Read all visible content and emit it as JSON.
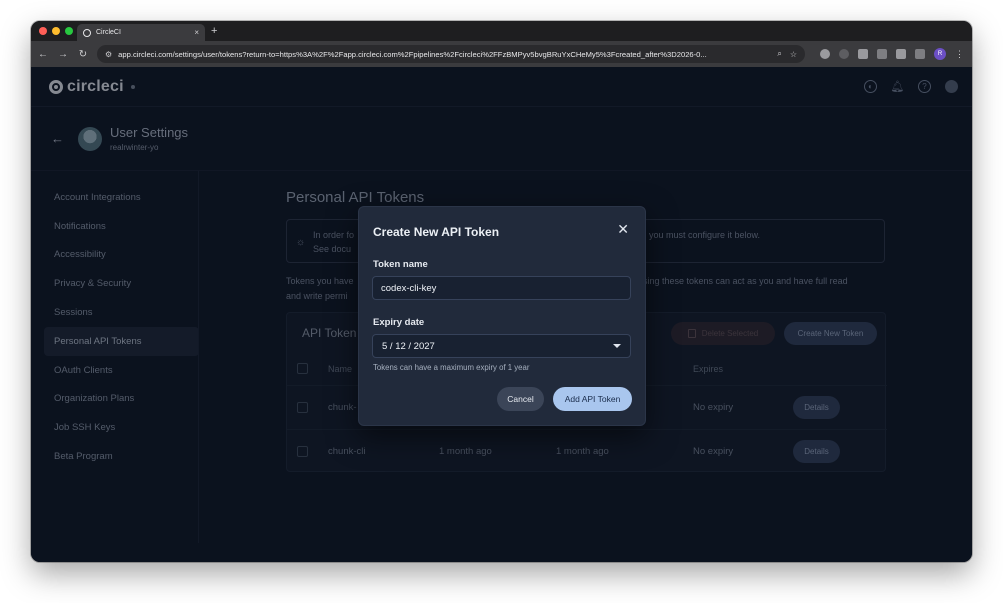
{
  "browser": {
    "tab_title": "CircleCI",
    "tab_close": "×",
    "new_tab": "+",
    "url": "app.circleci.com/settings/user/tokens?return-to=https%3A%2F%2Fapp.circleci.com%2Fpipelines%2Fcircleci%2FFzBMPyv5bvgBRuYxCHeMy5%3Fcreated_after%3D2026-0...",
    "profile_initial": "R",
    "traffic_light_colors": [
      "#ff5f57",
      "#febc2e",
      "#28c840"
    ]
  },
  "app": {
    "logo_text": "circleci"
  },
  "user": {
    "title": "User Settings",
    "handle": "realrwinter-yo"
  },
  "sidebar": {
    "items": [
      {
        "label": "Account Integrations"
      },
      {
        "label": "Notifications"
      },
      {
        "label": "Accessibility"
      },
      {
        "label": "Privacy & Security"
      },
      {
        "label": "Sessions"
      },
      {
        "label": "Personal API Tokens",
        "active": true
      },
      {
        "label": "OAuth Clients"
      },
      {
        "label": "Organization Plans"
      },
      {
        "label": "Job SSH Keys"
      },
      {
        "label": "Beta Program"
      }
    ]
  },
  "main": {
    "title": "Personal API Tokens",
    "banner_line1_left": "In order fo",
    "banner_line2_left": "See docu",
    "banner_line1_right": "you must configure it below.",
    "desc_line1_left": "Tokens you have",
    "desc_line2_left": "and write permi",
    "desc_line1_right": "sing these tokens can act as you and have full read"
  },
  "table": {
    "title": "API Token",
    "delete_label": "Delete Selected",
    "create_label": "Create New Token",
    "col_name": "Name",
    "col_expires": "Expires",
    "rows": [
      {
        "name": "chunk-",
        "created": "",
        "last_used": "",
        "expires": "No expiry",
        "action": "Details"
      },
      {
        "name": "chunk-cli",
        "created": "1 month ago",
        "last_used": "1 month ago",
        "expires": "No expiry",
        "action": "Details"
      }
    ]
  },
  "modal": {
    "title": "Create New API Token",
    "close": "✕",
    "token_name_label": "Token name",
    "token_name_value": "codex-cli-key",
    "expiry_label": "Expiry date",
    "expiry_value": "5 / 12 / 2027",
    "help": "Tokens can have a maximum expiry of 1 year",
    "cancel": "Cancel",
    "submit": "Add API Token"
  }
}
